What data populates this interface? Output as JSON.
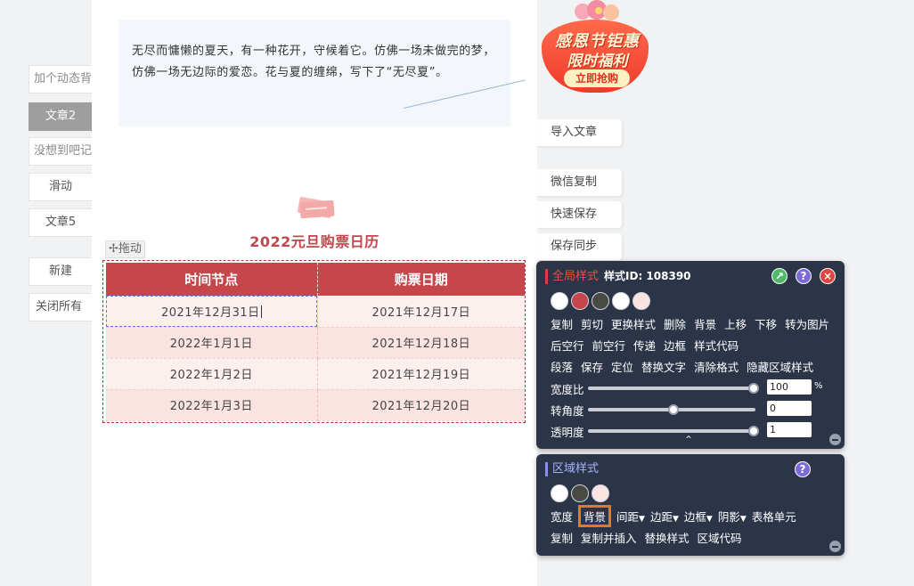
{
  "left_tabs": [
    "加个动态背",
    "文章2",
    "没想到吧记",
    "滑动",
    "文章5",
    "新建",
    "关闭所有"
  ],
  "intro_text": "无尽而慵懒的夏天，有一种花开，守候着它。仿佛一场未做完的梦，仿佛一场无边际的爱恋。花与夏的缠绵，写下了“无尽夏”。",
  "calendar": {
    "title": "2022元旦购票日历",
    "headers": [
      "时间节点",
      "购票日期"
    ],
    "rows": [
      [
        "2021年12月31日",
        "2021年12月17日"
      ],
      [
        "2022年1月1日",
        "2021年12月18日"
      ],
      [
        "2022年1月2日",
        "2021年12月19日"
      ],
      [
        "2022年1月3日",
        "2021年12月20日"
      ]
    ]
  },
  "drag_label": "✢拖动",
  "promo": {
    "line1": "感恩节钜惠",
    "line2": "限时福利",
    "button": "立即抢购"
  },
  "side_buttons": [
    "导入文章",
    "微信复制",
    "快速保存",
    "保存同步"
  ],
  "global_panel": {
    "title": "全局样式",
    "style_id": "样式ID: 108390",
    "swatch_colors": [
      "#ffffff",
      "#c5464b",
      "#4a4a45",
      "#ffffff",
      "#fbe3e2"
    ],
    "row1": [
      "复制",
      "剪切",
      "更换样式",
      "删除",
      "背景",
      "上移",
      "下移",
      "转为图片"
    ],
    "row2": [
      "后空行",
      "前空行",
      "传递",
      "边框",
      "样式代码"
    ],
    "row3": [
      "段落",
      "保存",
      "定位",
      "替换文字",
      "清除格式",
      "隐藏区域样式"
    ],
    "sliders": [
      {
        "label": "宽度比",
        "value": "100",
        "unit": "%",
        "level": 1.0
      },
      {
        "label": "转角度",
        "value": "0",
        "unit": "",
        "level": 0.5
      },
      {
        "label": "透明度",
        "value": "1",
        "unit": "",
        "level": 1.0
      }
    ],
    "icons": [
      "share-icon",
      "help-icon",
      "close-icon"
    ]
  },
  "region_panel": {
    "title": "区域样式",
    "swatch_colors": [
      "#ffffff",
      "#4a4a45",
      "#fbe3e2"
    ],
    "row1": [
      "宽度",
      "背景",
      "间距",
      "边距",
      "边框",
      "阴影",
      "表格单元"
    ],
    "row2": [
      "复制",
      "复制并插入",
      "替换样式",
      "区域代码"
    ],
    "highlighted": "背景"
  }
}
